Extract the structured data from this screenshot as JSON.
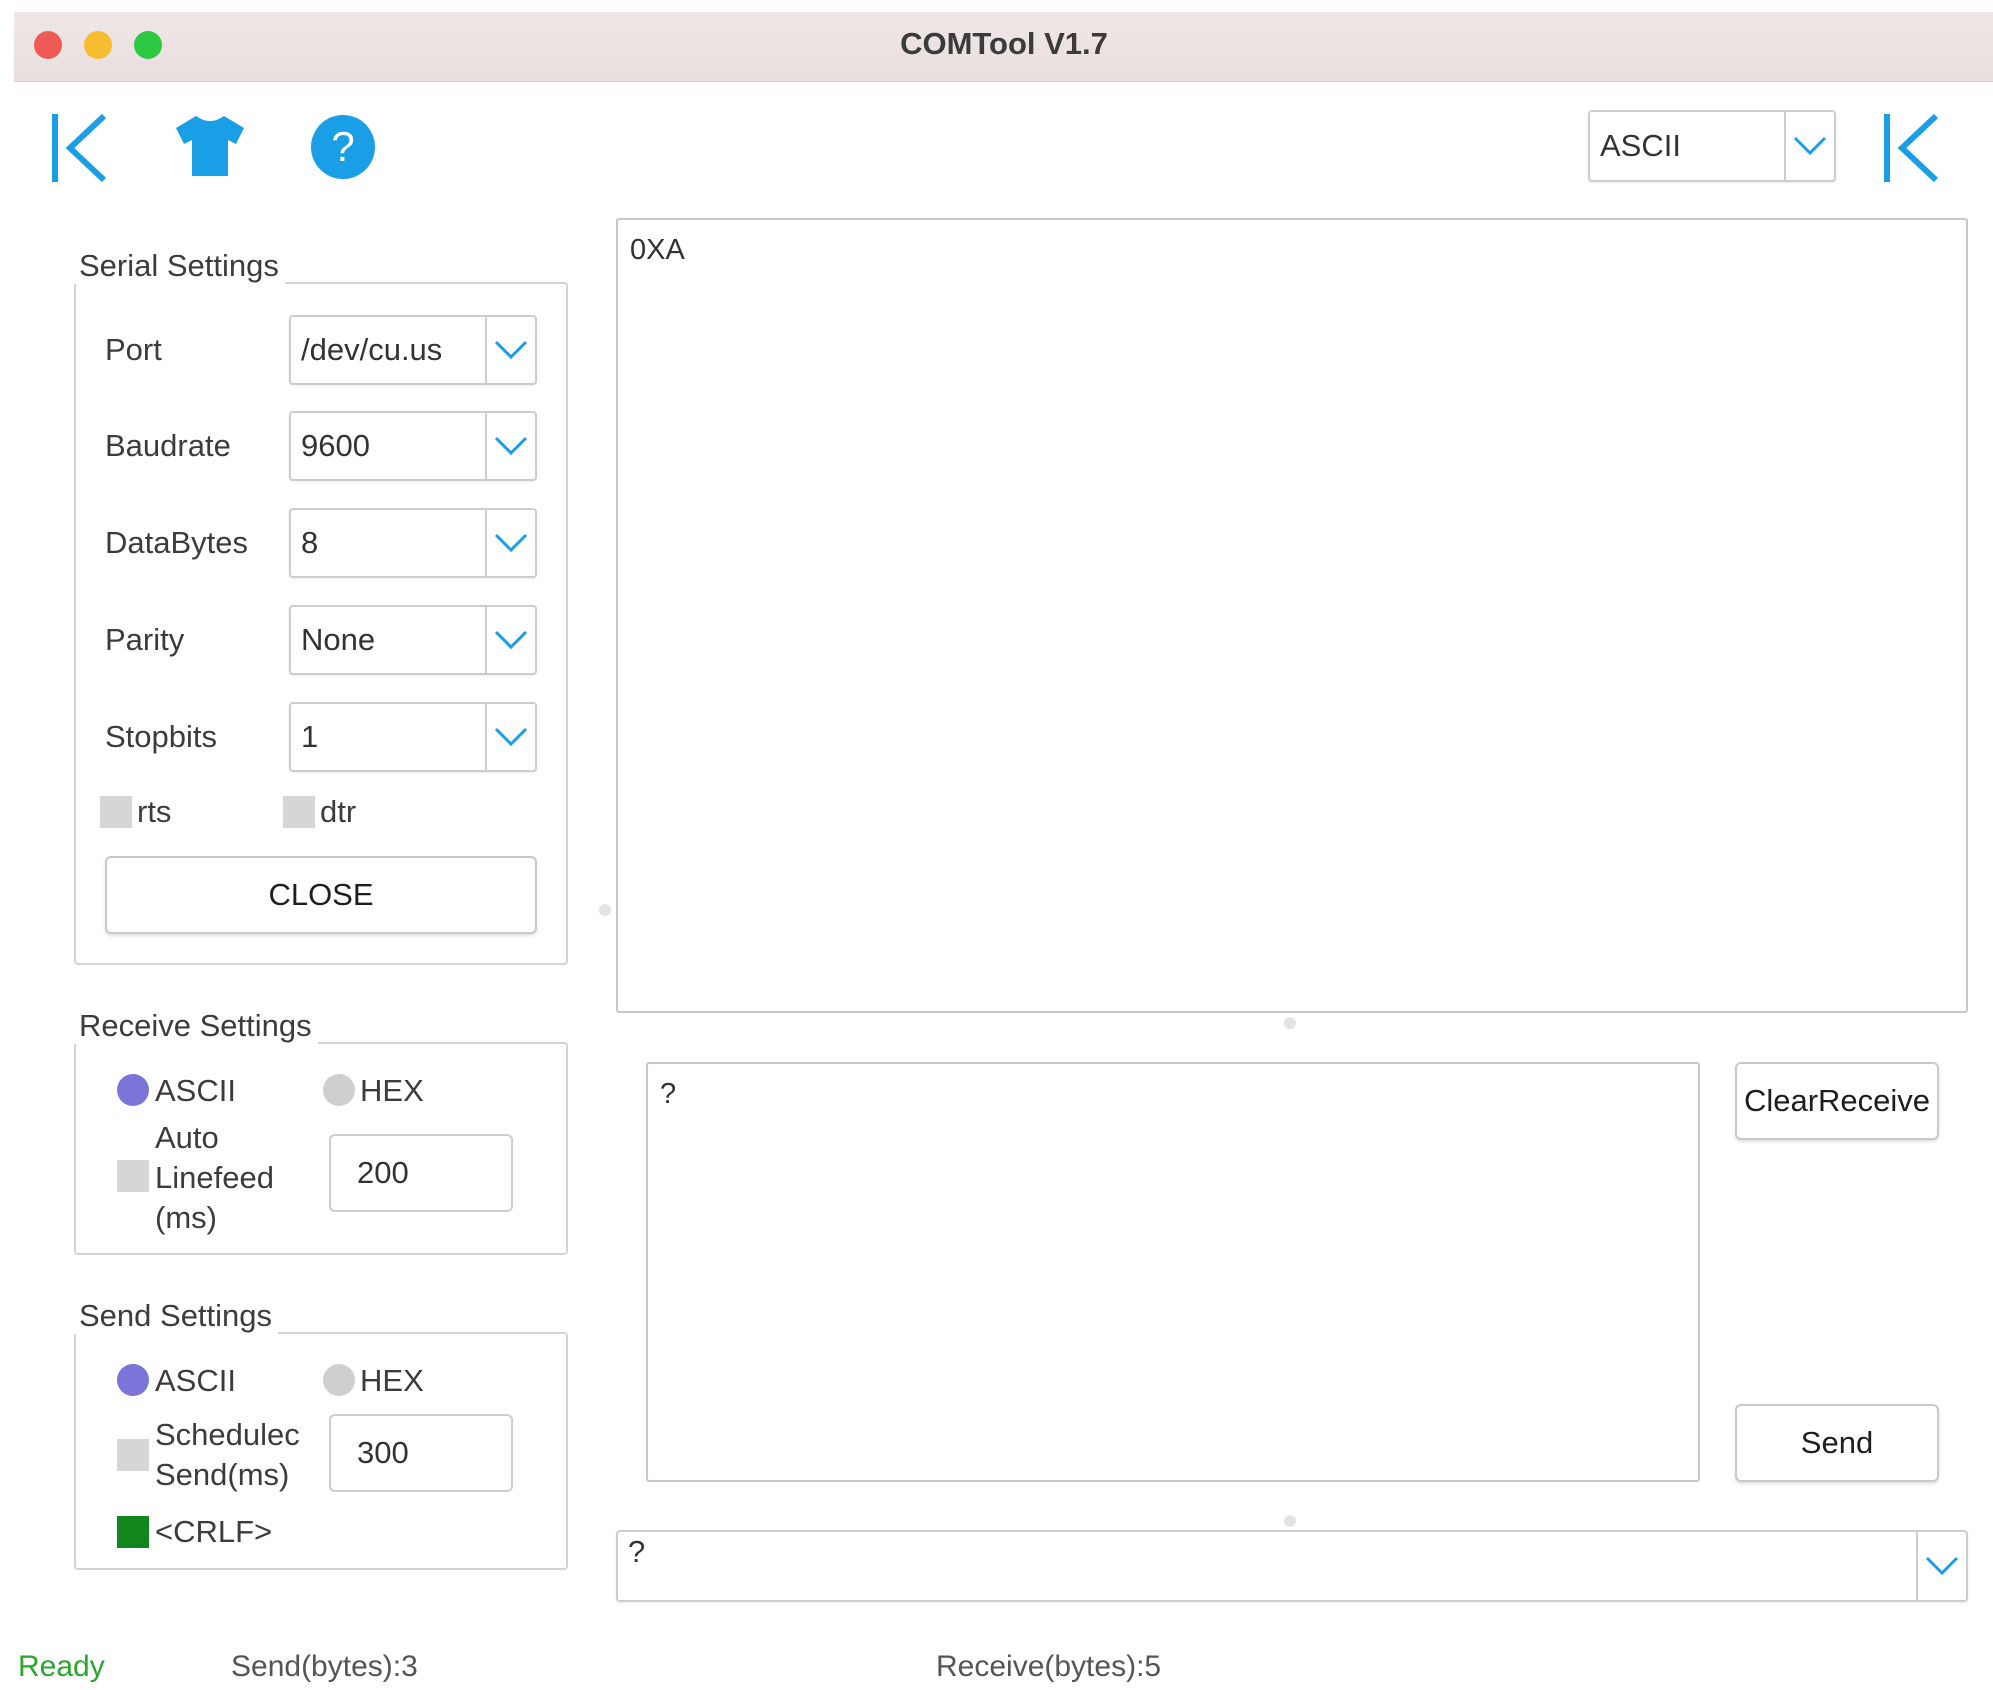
{
  "window": {
    "title": "COMTool V1.7"
  },
  "toolbar": {
    "collapse_left_icon": "collapse-left-icon",
    "skin_icon": "tshirt-icon",
    "help_icon": "help-icon",
    "help_glyph": "?",
    "encoding_select": {
      "value": "ASCII"
    },
    "collapse_right_icon": "collapse-right-icon"
  },
  "serial_settings": {
    "title": "Serial Settings",
    "port": {
      "label": "Port",
      "value": "/dev/cu.us"
    },
    "baudrate": {
      "label": "Baudrate",
      "value": "9600"
    },
    "databytes": {
      "label": "DataBytes",
      "value": "8"
    },
    "parity": {
      "label": "Parity",
      "value": "None"
    },
    "stopbits": {
      "label": "Stopbits",
      "value": "1"
    },
    "rts": {
      "label": "rts",
      "checked": false
    },
    "dtr": {
      "label": "dtr",
      "checked": false
    },
    "close_button": "CLOSE"
  },
  "receive_settings": {
    "title": "Receive Settings",
    "ascii_label": "ASCII",
    "hex_label": "HEX",
    "selected": "ASCII",
    "auto_linefeed": {
      "label_line1": "Auto",
      "label_line2": "Linefeed",
      "label_line3": "(ms)",
      "checked": false,
      "value": "200"
    }
  },
  "send_settings": {
    "title": "Send Settings",
    "ascii_label": "ASCII",
    "hex_label": "HEX",
    "selected": "ASCII",
    "scheduled": {
      "label_line1": "Schedulec",
      "label_line2": "Send(ms)",
      "checked": false,
      "value": "300"
    },
    "crlf": {
      "label": "<CRLF>",
      "checked": true
    }
  },
  "receive_area": {
    "content": "0XA"
  },
  "send_area": {
    "content": "?",
    "clear_receive_button": "ClearReceive",
    "send_button": "Send"
  },
  "history_combo": {
    "value": "?"
  },
  "status_bar": {
    "state": "Ready",
    "sent": "Send(bytes):3",
    "received": "Receive(bytes):5"
  },
  "colors": {
    "accent": "#1a9ee6",
    "radio_selected": "#7b74d9",
    "radio_unselected": "#cfcfcf",
    "crlf_checked": "#11861d",
    "status_ready": "#2aa52e",
    "traffic_red": "#ee5b54",
    "traffic_yellow": "#f5bd2f",
    "traffic_green": "#2bc840"
  }
}
